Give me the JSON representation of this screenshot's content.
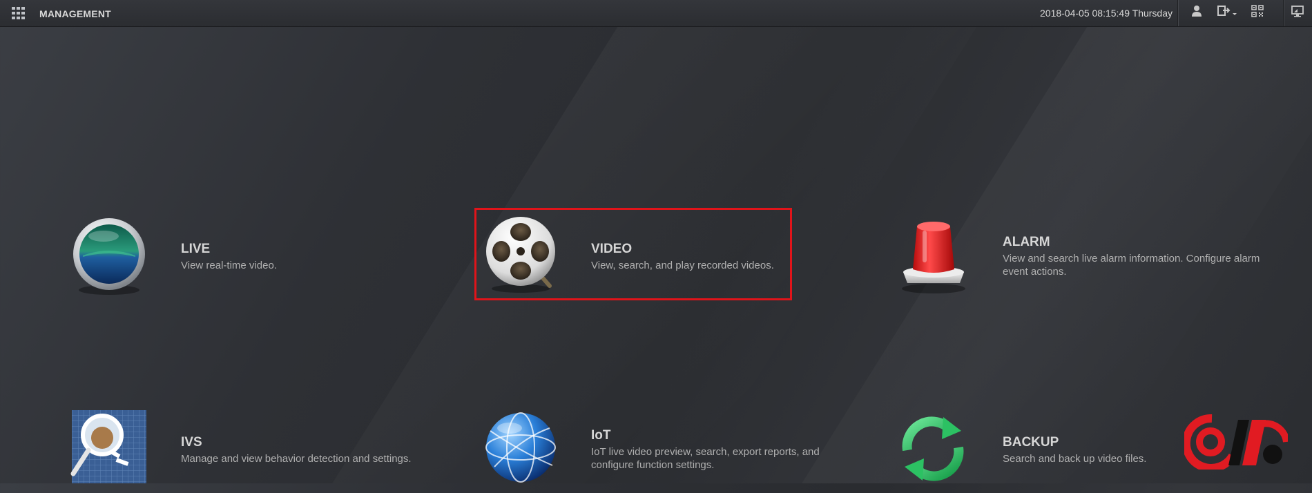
{
  "header": {
    "app_title": "MANAGEMENT",
    "datetime": "2018-04-05 08:15:49 Thursday",
    "icons": [
      "grid-menu-icon",
      "user-icon",
      "logout-icon",
      "qr-code-icon",
      "monitor-icon"
    ]
  },
  "tiles": [
    {
      "id": "live",
      "title": "LIVE",
      "description": "View real-time video.",
      "icon": "live-dome-icon"
    },
    {
      "id": "video",
      "title": "VIDEO",
      "description": "View, search, and play recorded videos.",
      "icon": "film-reel-icon"
    },
    {
      "id": "alarm",
      "title": "ALARM",
      "description": "View and search live alarm information. Configure alarm event actions.",
      "icon": "alarm-siren-icon"
    },
    {
      "id": "ivs",
      "title": "IVS",
      "description": "Manage and view behavior detection and settings.",
      "icon": "magnifier-icon"
    },
    {
      "id": "iot",
      "title": "IoT",
      "description": "IoT live video preview, search, export reports, and configure function settings.",
      "icon": "globe-icon"
    },
    {
      "id": "backup",
      "title": "BACKUP",
      "description": "Search and back up video files.",
      "icon": "sync-arrows-icon"
    }
  ],
  "colors": {
    "highlight_border": "#e0141a",
    "background": "#2e3035",
    "title_text": "#d6d6d6",
    "desc_text": "#b0b0b0"
  }
}
